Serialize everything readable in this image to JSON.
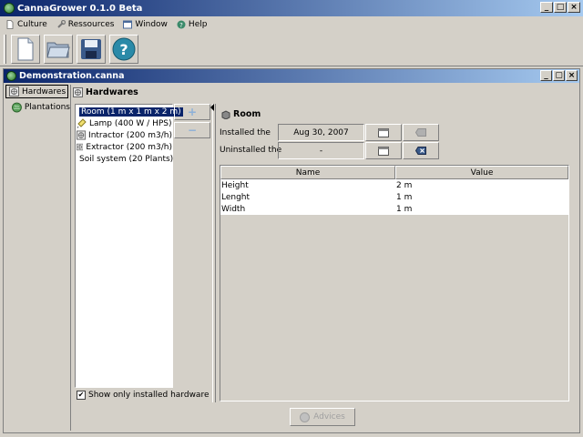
{
  "window": {
    "title": "CannaGrower 0.1.0 Beta"
  },
  "menu": [
    {
      "label": "Culture",
      "icon": "page-icon"
    },
    {
      "label": "Ressources",
      "icon": "wrench-icon"
    },
    {
      "label": "Window",
      "icon": "window-icon"
    },
    {
      "label": "Help",
      "icon": "help-icon"
    }
  ],
  "toolbar": [
    "new-document-icon",
    "open-folder-icon",
    "save-disk-icon",
    "help-circle-icon"
  ],
  "document": {
    "title": "Demonstration.canna",
    "nav": [
      {
        "label": "Hardwares",
        "selected": true
      },
      {
        "label": "Plantations",
        "selected": false
      }
    ],
    "section_title": "Hardwares",
    "hardware_items": [
      {
        "label": "Room (1 m x 1 m x 2 m)",
        "icon": "room-icon",
        "selected": true
      },
      {
        "label": "Lamp (400 W / HPS)",
        "icon": "lamp-icon",
        "selected": false
      },
      {
        "label": "Intractor (200 m3/h)",
        "icon": "fan-icon",
        "selected": false
      },
      {
        "label": "Extractor (200 m3/h)",
        "icon": "fan-icon",
        "selected": false
      },
      {
        "label": "Soil system (20 Plants)",
        "icon": "soil-icon",
        "selected": false
      }
    ],
    "add_label": "+",
    "remove_label": "−",
    "show_installed_label": "Show only installed hardware",
    "show_installed_checked": true,
    "detail": {
      "title": "Room",
      "installed_label": "Installed the",
      "installed_value": "Aug 30, 2007",
      "uninstalled_label": "Uninstalled the",
      "uninstalled_value": "-",
      "columns": [
        "Name",
        "Value"
      ],
      "rows": [
        [
          "Height",
          "2 m"
        ],
        [
          "Lenght",
          "1 m"
        ],
        [
          "Width",
          "1 m"
        ]
      ]
    },
    "advices_label": "Advices"
  },
  "colors": {
    "titlebar_start": "#0a246a",
    "titlebar_end": "#a6caf0",
    "face": "#d4d0c8"
  }
}
